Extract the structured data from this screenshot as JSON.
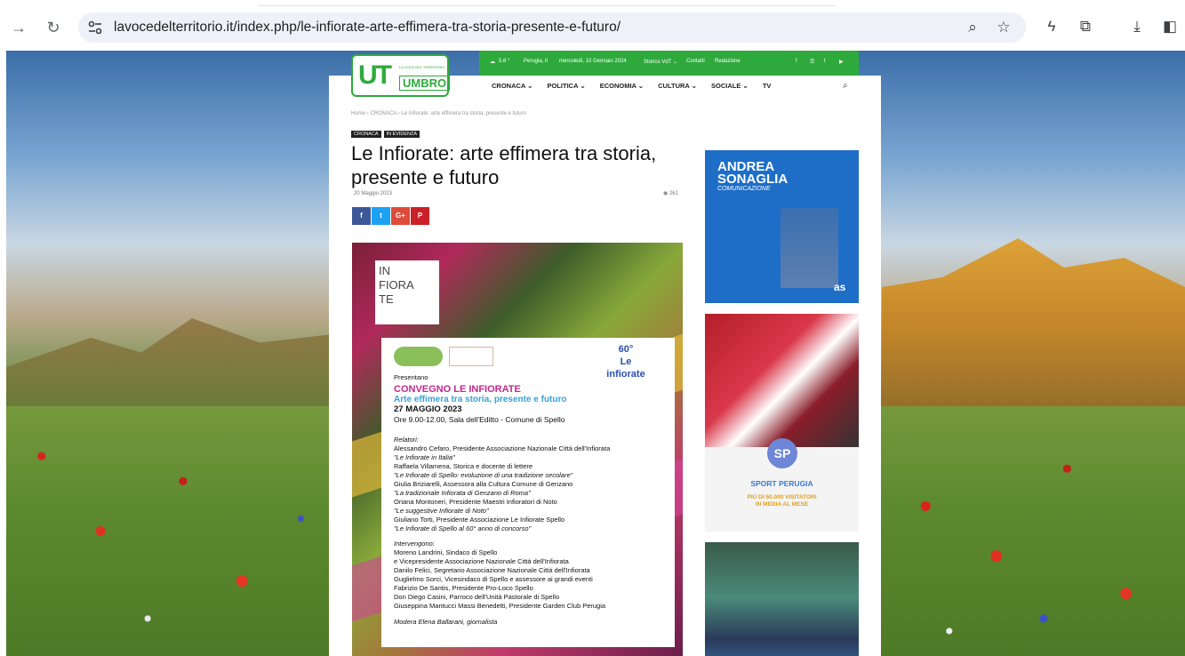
{
  "browser": {
    "url": "lavocedelterritorio.it/index.php/le-infiorate-arte-effimera-tra-storia-presente-e-futuro/"
  },
  "site": {
    "logo": {
      "ut": "UT",
      "umbro": "UMBRO",
      "tagline": "LA VOCE DEL TERRITORIO"
    },
    "topbar": {
      "weather": "5.6 °",
      "city": "Perugia, it",
      "date": "mercoledì, 10 Gennaio 2024",
      "links": [
        "Storico VdT ⌄",
        "Contatti",
        "Redazione"
      ],
      "social": [
        "f",
        "☰",
        "t",
        "▶"
      ]
    },
    "menu": [
      "CRONACA ⌄",
      "POLITICA ⌄",
      "ECONOMIA ⌄",
      "CULTURA ⌄",
      "SOCIALE ⌄",
      "TV"
    ]
  },
  "article": {
    "breadcrumb": "Home  ›  CRONACA  ›  Le Infiorate: arte effimera tra storia, presente e futuro",
    "tags": [
      "CRONACA",
      "IN EVIDENZA"
    ],
    "title": "Le Infiorate: arte effimera tra storia, presente e futuro",
    "date": "20 Maggio 2023",
    "views": "261",
    "share": [
      {
        "label": "f",
        "color": "#3b5998"
      },
      {
        "label": "t",
        "color": "#1da1f2"
      },
      {
        "label": "G+",
        "color": "#dd4b39"
      },
      {
        "label": "P",
        "color": "#cb2027"
      }
    ]
  },
  "poster": {
    "infiorate_logo": "IN\nFIORA\nTE",
    "logo3": "60°\nLe infiorate",
    "lines": [
      "Presentano",
      "CONVEGNO LE INFIORATE",
      "Arte effimera tra storia, presente e futuro",
      "27 MAGGIO 2023",
      "Ore 9.00-12.00, Sala dell'Editto - Comune di Spello",
      "Relatori:",
      "Alessandro Cefaro, Presidente Associazione Nazionale Città dell'Infiorata",
      "\"Le Infiorate in Italia\"",
      "Raffaela Villamena, Storica e docente di lettere",
      "\"Le Infiorate di Spello: evoluzione di una tradizione secolare\"",
      "Giulia Briziarelli, Assessora alla Cultura Comune di Genzano",
      "\"La tradizionale Infiorata di Genzano di Roma\"",
      "Oriana Montoneri, Presidente Maestri Infioratori di Noto",
      "\"Le suggestive Infiorate di Noto\"",
      "Giuliano Torti, Presidente Associazione Le Infiorate Spello",
      "\"Le Infiorate di Spello al 60° anno di concorso\"",
      "Intervengono:",
      "Moreno Landrini, Sindaco di Spello",
      "e Vicepresidente Associazione Nazionale Città dell'Infiorata",
      "Danilo Felici, Segretario Associazione Nazionale Città dell'Infiorata",
      "Guglielmo Sorci, Vicesindaco di Spello e assessore ai grandi eventi",
      "Fabrizio De Santis, Presidente Pro-Loco Spello",
      "Don Diego Casini, Parroco dell'Unità Pastorale di Spello",
      "Giuseppina Mantucci Massi Benedetti, Presidente Garden Club Perugia",
      "Modera Elena Ballarani, giornalista"
    ]
  },
  "sidebar": {
    "ad1": {
      "line1": "ANDREA",
      "line2": "SONAGLIA",
      "sub": "COMUNICAZIONE",
      "mark": "as"
    },
    "ad2": {
      "badge": "SP",
      "title": "SPORT PERUGIA",
      "line1": "PIÙ DI 50.000 VISITATORI",
      "line2": "IN MEDIA AL MESE"
    }
  }
}
